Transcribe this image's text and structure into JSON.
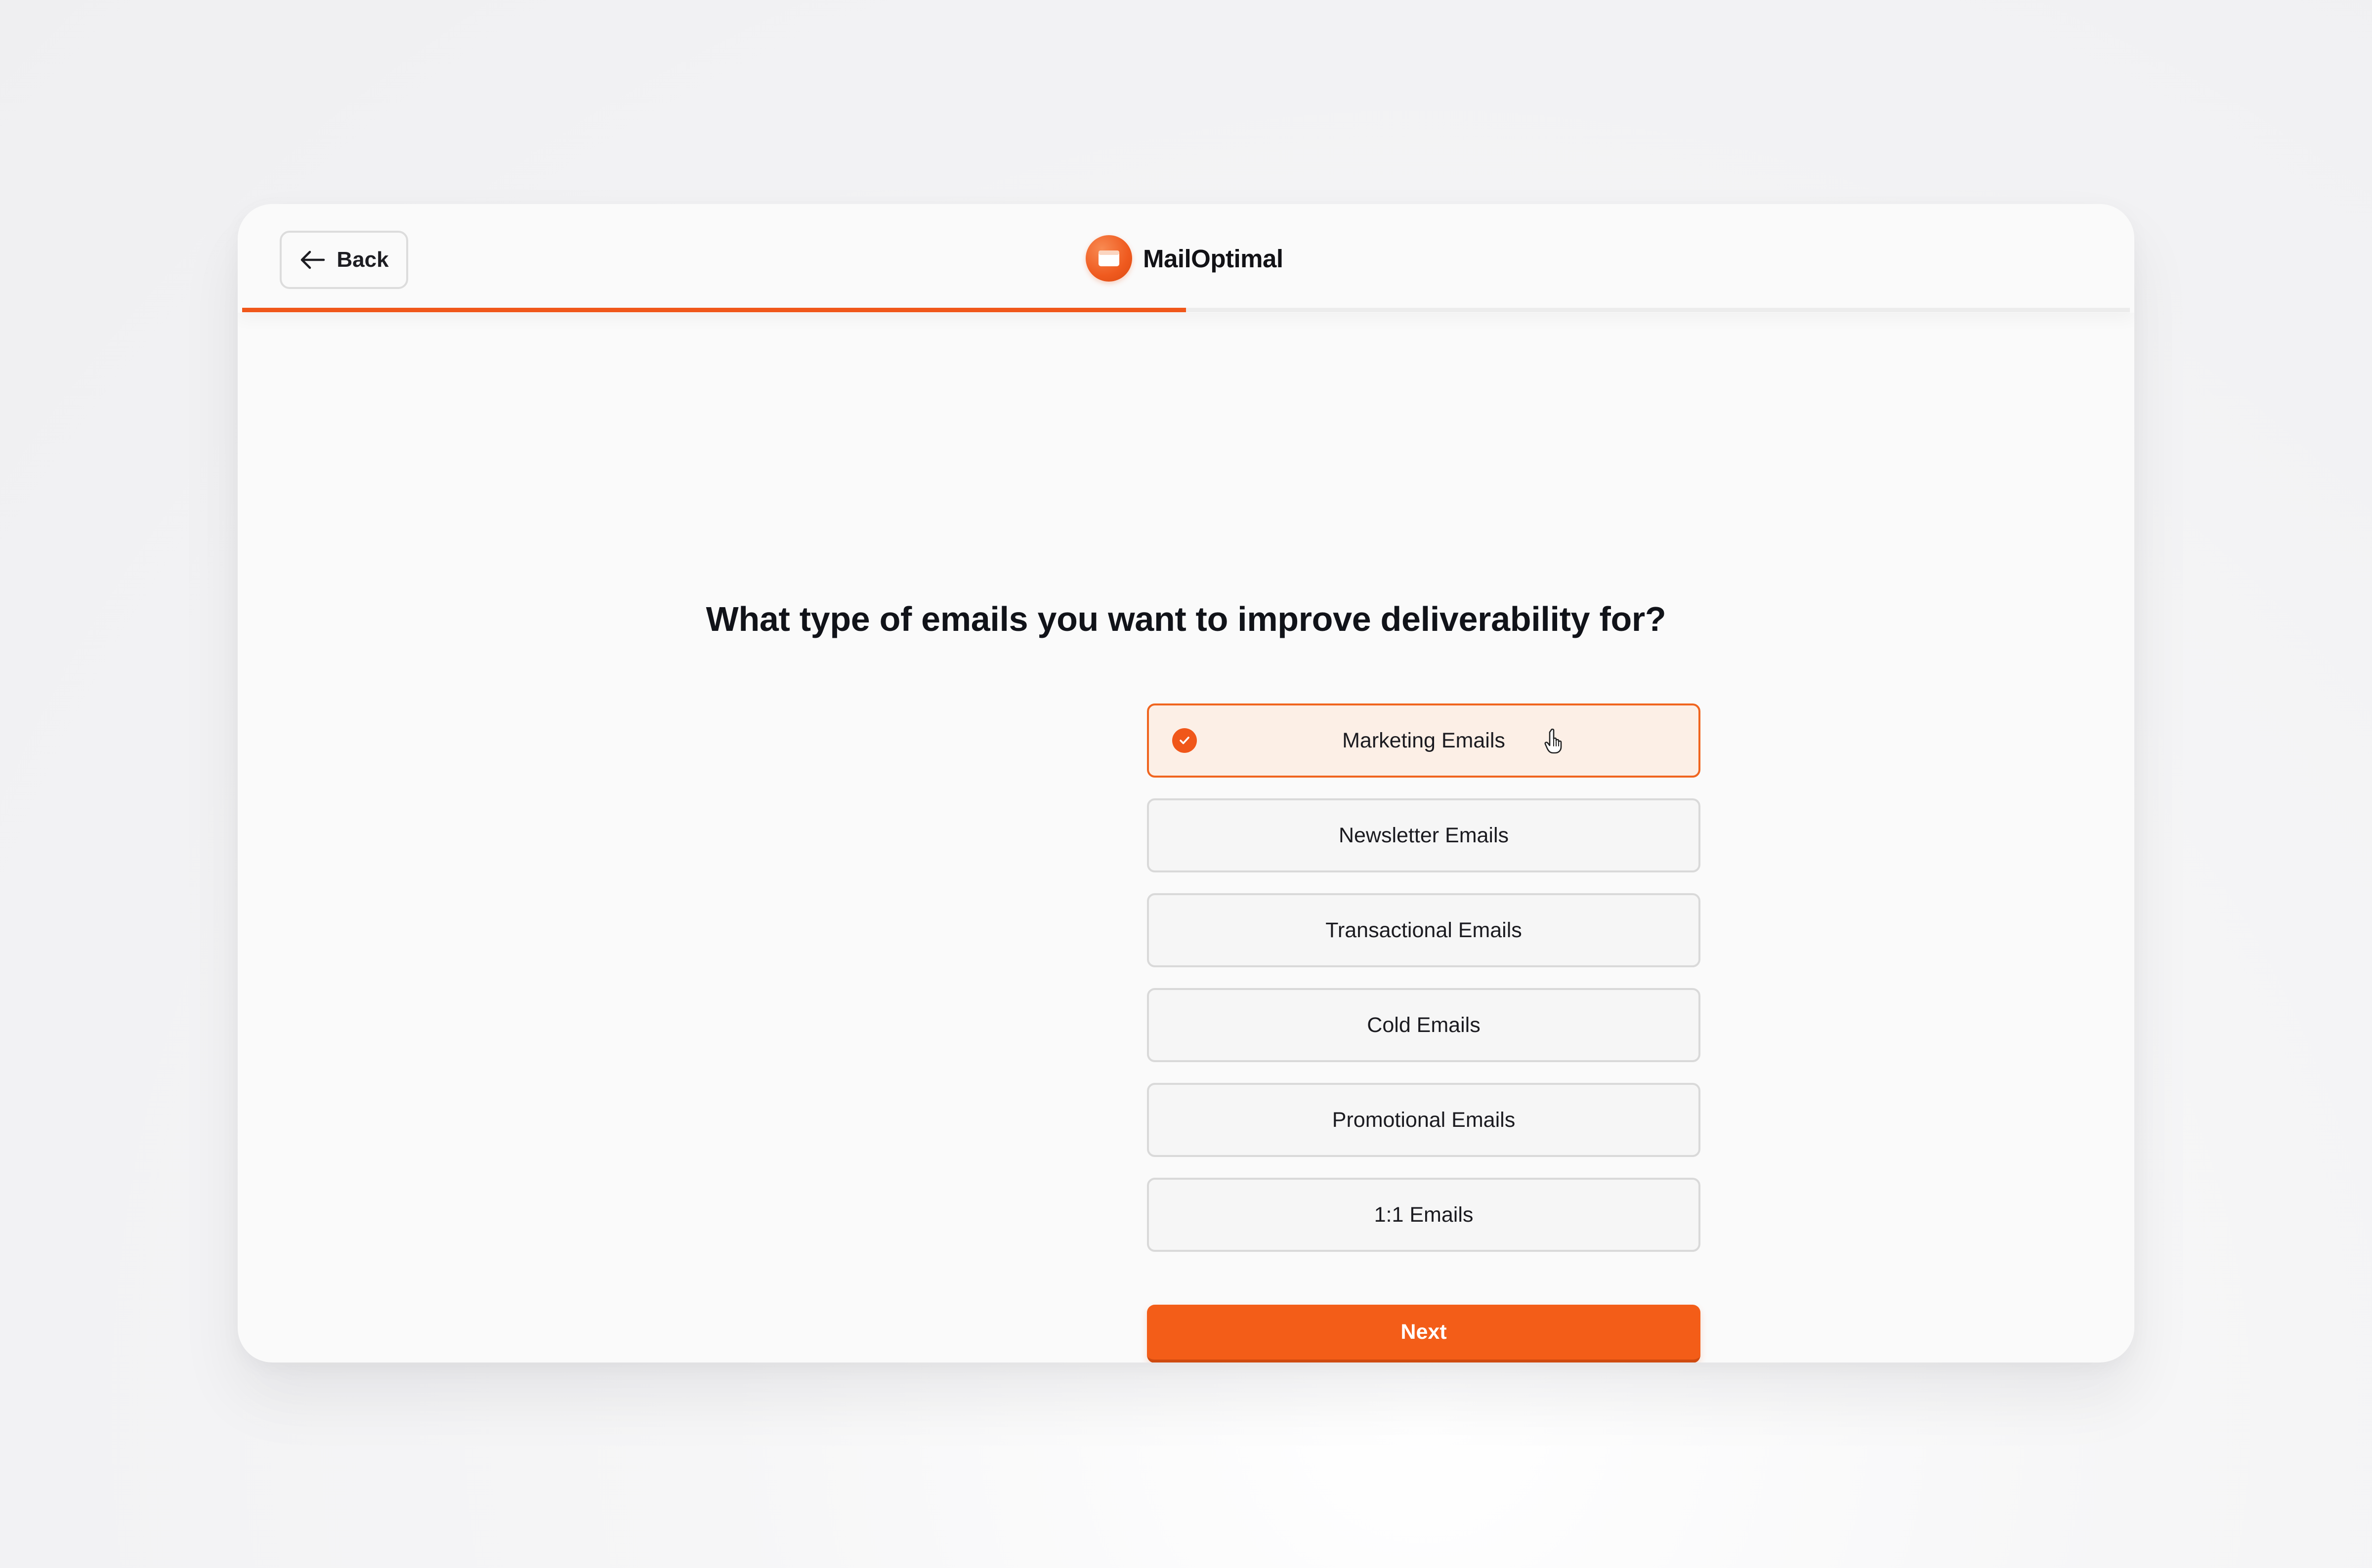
{
  "header": {
    "back_label": "Back",
    "brand_name": "MailOptimal",
    "progress": 0.5
  },
  "question": "What type of emails you want to improve deliverability for?",
  "options": [
    {
      "label": "Marketing Emails",
      "selected": true
    },
    {
      "label": "Newsletter Emails",
      "selected": false
    },
    {
      "label": "Transactional Emails",
      "selected": false
    },
    {
      "label": "Cold Emails",
      "selected": false
    },
    {
      "label": "Promotional Emails",
      "selected": false
    },
    {
      "label": "1:1 Emails",
      "selected": false
    }
  ],
  "next_label": "Next",
  "colors": {
    "accent": "#f0571a",
    "selected_bg": "#fcefe6",
    "card_bg": "#fafafa"
  },
  "icons": {
    "back": "arrow-left-icon",
    "logo": "mail-icon",
    "selected": "check-icon",
    "cursor": "hand-pointer-icon"
  }
}
